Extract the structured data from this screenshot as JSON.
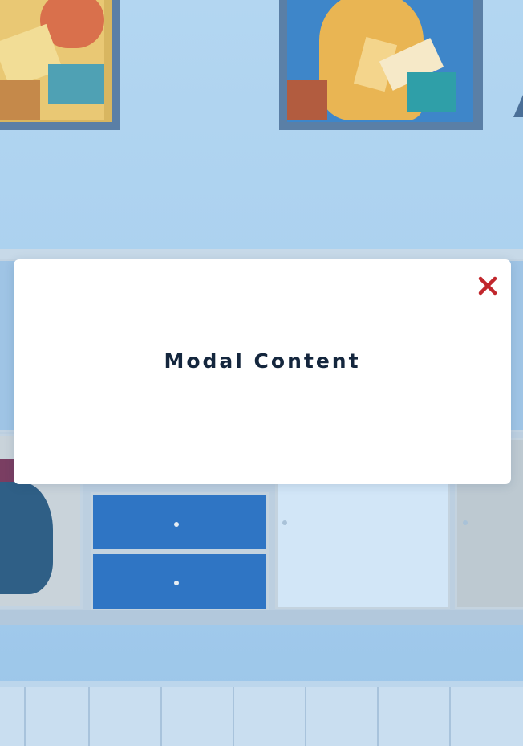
{
  "modal": {
    "title": "Modal Content",
    "close_icon": "close-icon",
    "close_color": "#c1272d"
  },
  "colors": {
    "overlay_tint": "#a9d0ef",
    "modal_background": "#ffffff",
    "title_text": "#14263d"
  }
}
